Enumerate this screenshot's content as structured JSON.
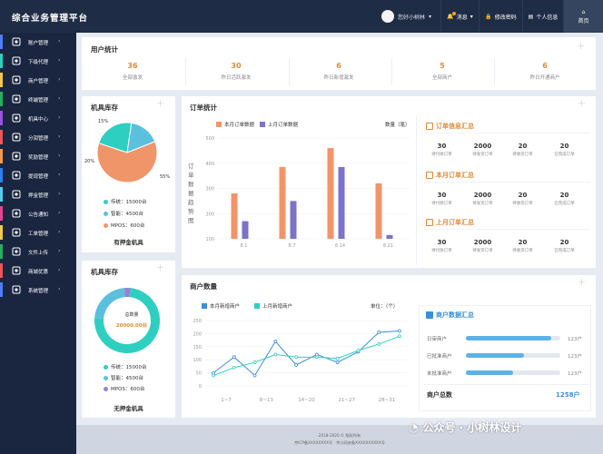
{
  "header": {
    "title": "综合业务管理平台",
    "user": "您好小树林",
    "notice": "消息",
    "change_pwd": "修改密码",
    "profile": "个人信息",
    "home": "首页"
  },
  "sidebar": {
    "items": [
      {
        "label": "账户管理",
        "color": "#4f7cf7",
        "icon": "user-gear-icon"
      },
      {
        "label": "下级代理",
        "color": "#2ecfc0",
        "icon": "agent-icon"
      },
      {
        "label": "商户管理",
        "color": "#f2c94c",
        "icon": "shop-icon"
      },
      {
        "label": "终端管理",
        "color": "#27ae60",
        "icon": "terminal-icon"
      },
      {
        "label": "机具中心",
        "color": "#9b51e0",
        "icon": "device-icon"
      },
      {
        "label": "分润管理",
        "color": "#eb5757",
        "icon": "profit-icon"
      },
      {
        "label": "奖励管理",
        "color": "#f2994a",
        "icon": "reward-icon"
      },
      {
        "label": "提现管理",
        "color": "#2f80ed",
        "icon": "withdraw-icon"
      },
      {
        "label": "押金管理",
        "color": "#56ccf2",
        "icon": "deposit-icon"
      },
      {
        "label": "公告通知",
        "color": "#e84393",
        "icon": "notice-icon"
      },
      {
        "label": "工单管理",
        "color": "#f2c94c",
        "icon": "ticket-icon"
      },
      {
        "label": "文件上传",
        "color": "#27ae60",
        "icon": "upload-icon"
      },
      {
        "label": "商城优惠",
        "color": "#eb5757",
        "icon": "mall-icon"
      },
      {
        "label": "系统管理",
        "color": "#4f7cf7",
        "icon": "system-icon"
      }
    ]
  },
  "user_stats": {
    "title": "用户统计",
    "items": [
      {
        "value": "36",
        "label": "全部激发"
      },
      {
        "value": "30",
        "label": "昨日活跃激发"
      },
      {
        "value": "6",
        "label": "昨日新增激发"
      },
      {
        "value": "5",
        "label": "全部商户"
      },
      {
        "value": "6",
        "label": "昨日开通商户"
      }
    ]
  },
  "inventory_a": {
    "title": "机具库存",
    "footer": "有押金机具",
    "percent_labels": [
      "15%",
      "20%",
      "55%"
    ],
    "legend": [
      {
        "label": "传统：15000台",
        "color": "#2ecfc0"
      },
      {
        "label": "智能：4500台",
        "color": "#5bc0de"
      },
      {
        "label": "MPOS：600台",
        "color": "#f0956a"
      }
    ],
    "slices": [
      {
        "value": 55,
        "color": "#f0956a"
      },
      {
        "value": 20,
        "color": "#2ecfc0"
      },
      {
        "value": 15,
        "color": "#5bc0de"
      }
    ]
  },
  "inventory_b": {
    "title": "机具库存",
    "footer": "无押金机具",
    "center_label": "总数量",
    "center_value": "20000.00台",
    "legend": [
      {
        "label": "传统：15000台",
        "color": "#2ecfc0"
      },
      {
        "label": "智能：4500台",
        "color": "#5bc0de"
      },
      {
        "label": "MPOS：600台",
        "color": "#9b7ed9"
      }
    ],
    "slices": [
      {
        "value": 75,
        "color": "#2ecfc0"
      },
      {
        "value": 22.5,
        "color": "#5bc0de"
      },
      {
        "value": 3,
        "color": "#9b7ed9"
      }
    ]
  },
  "order_stats": {
    "title": "订单统计",
    "unit": "数量（笔）",
    "yaxis_title": "订单数据趋势图"
  },
  "order_summary": {
    "sections": [
      {
        "title": "订单信息汇总",
        "values": [
          "30",
          "2000",
          "20",
          "20"
        ],
        "labels": [
          "待付款订单",
          "待发货订单",
          "待收货订单",
          "已完成订单"
        ]
      },
      {
        "title": "本月订单汇总",
        "values": [
          "30",
          "2000",
          "20",
          "20"
        ],
        "labels": [
          "待付款订单",
          "待发货订单",
          "待收货订单",
          "已完成订单"
        ]
      },
      {
        "title": "上月订单汇总",
        "values": [
          "30",
          "2000",
          "20",
          "20"
        ],
        "labels": [
          "待付款订单",
          "待发货订单",
          "待收货订单",
          "已完成订单"
        ]
      }
    ]
  },
  "merchant": {
    "title": "商户数量",
    "unit": "单位：（个）",
    "summary_title": "商户数据汇总",
    "rows": [
      {
        "label": "日审商户",
        "value": "123户",
        "fill": 0.9
      },
      {
        "label": "已批准商户",
        "value": "123户",
        "fill": 0.62
      },
      {
        "label": "未批准商户",
        "value": "123户",
        "fill": 0.5
      }
    ],
    "total_label": "商户总数",
    "total_value": "1258户"
  },
  "footer": {
    "line1": "2018-2020 © 版权所有",
    "line2": "京ICP备XXXXXXXX号 · 京公网安备XXXXXXXXXX号"
  },
  "watermark": "公众号 · 小树林设计",
  "chart_data": [
    {
      "type": "bar",
      "title": "订单统计",
      "ylabel": "订单数据趋势图",
      "categories": [
        "8.1",
        "8.7",
        "8.14",
        "8.21"
      ],
      "ylim": [
        100,
        500
      ],
      "yticks": [
        100,
        200,
        300,
        400,
        500
      ],
      "series": [
        {
          "name": "本月订单数据",
          "color": "#f0956a",
          "values": [
            280,
            385,
            460,
            320
          ]
        },
        {
          "name": "上月订单数据",
          "color": "#7b72c9",
          "values": [
            170,
            250,
            385,
            115
          ]
        }
      ]
    },
    {
      "type": "line",
      "title": "商户数量",
      "categories": [
        "1~7",
        "8~13",
        "14~20",
        "21~27",
        "28~31"
      ],
      "ylim": [
        0,
        250
      ],
      "yticks": [
        0,
        50,
        100,
        150,
        200,
        250
      ],
      "series": [
        {
          "name": "本月新增商户",
          "color": "#3a8fd9",
          "values": [
            50,
            110,
            40,
            170,
            80,
            120,
            90,
            130,
            205,
            210
          ]
        },
        {
          "name": "上月新增商户",
          "color": "#2ecfc0",
          "values": [
            40,
            70,
            90,
            120,
            110,
            110,
            105,
            135,
            160,
            190
          ]
        }
      ]
    }
  ]
}
